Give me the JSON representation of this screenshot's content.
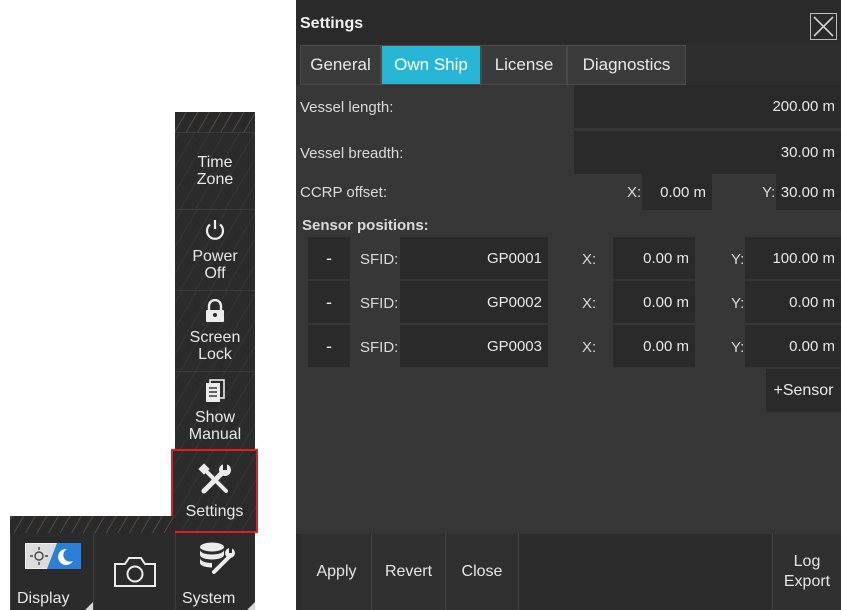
{
  "side_menu": {
    "time_zone": "Time Zone",
    "power_off": "Power Off",
    "screen_lock": "Screen Lock",
    "show_manual": "Show Manual",
    "settings": "Settings"
  },
  "dock": {
    "display": "Display",
    "camera_icon": "camera-icon",
    "system": "System"
  },
  "dialog": {
    "title": "Settings",
    "tabs": [
      "General",
      "Own Ship",
      "License",
      "Diagnostics"
    ],
    "active_tab": "Own Ship",
    "vessel_length_label": "Vessel length:",
    "vessel_length_value": "200.00 m",
    "vessel_breadth_label": "Vessel breadth:",
    "vessel_breadth_value": "30.00 m",
    "ccrp_label": "CCRP offset:",
    "ccrp_x_label": "X:",
    "ccrp_x_value": "0.00 m",
    "ccrp_y_label": "Y:",
    "ccrp_y_value": "30.00 m",
    "sensor_positions_label": "Sensor positions:",
    "sensors": [
      {
        "remove": "-",
        "sfid_label": "SFID:",
        "sfid": "GP0001",
        "x_label": "X:",
        "x": "0.00 m",
        "y_label": "Y:",
        "y": "100.00 m"
      },
      {
        "remove": "-",
        "sfid_label": "SFID:",
        "sfid": "GP0002",
        "x_label": "X:",
        "x": "0.00 m",
        "y_label": "Y:",
        "y": "0.00 m"
      },
      {
        "remove": "-",
        "sfid_label": "SFID:",
        "sfid": "GP0003",
        "x_label": "X:",
        "x": "0.00 m",
        "y_label": "Y:",
        "y": "0.00 m"
      }
    ],
    "add_sensor": "+Sensor",
    "footer": {
      "apply": "Apply",
      "revert": "Revert",
      "close": "Close",
      "log_export": "Log Export"
    }
  },
  "colors": {
    "accent_tab": "#27b6d6",
    "highlight_border": "#e02020",
    "panel_bg": "#373737"
  }
}
